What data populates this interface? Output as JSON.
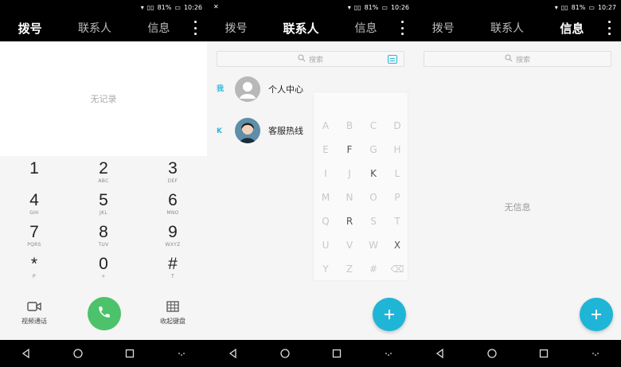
{
  "status": {
    "battery": "81%",
    "time_1": "10:26",
    "time_2": "10:26",
    "time_3": "10:27"
  },
  "tabs": {
    "dial": "拨号",
    "contacts": "联系人",
    "messages": "信息"
  },
  "dialer": {
    "empty_log": "无记录",
    "keys": [
      {
        "num": "1",
        "sub": ""
      },
      {
        "num": "2",
        "sub": "ABC"
      },
      {
        "num": "3",
        "sub": "DEF"
      },
      {
        "num": "4",
        "sub": "GHI"
      },
      {
        "num": "5",
        "sub": "JKL"
      },
      {
        "num": "6",
        "sub": "MNO"
      },
      {
        "num": "7",
        "sub": "PQRS"
      },
      {
        "num": "8",
        "sub": "TUV"
      },
      {
        "num": "9",
        "sub": "WXYZ"
      },
      {
        "num": "*",
        "sub": "P"
      },
      {
        "num": "0",
        "sub": "+"
      },
      {
        "num": "#",
        "sub": "T"
      }
    ],
    "video_call_label": "视频通话",
    "hide_keyboard_label": "收起键盘"
  },
  "contacts": {
    "search_placeholder": "搜索",
    "groups": [
      {
        "letter": "我",
        "name": "个人中心"
      },
      {
        "letter": "K",
        "name": "客服热线"
      }
    ],
    "alphabet": [
      "A",
      "B",
      "C",
      "D",
      "E",
      "F",
      "G",
      "H",
      "I",
      "J",
      "K",
      "L",
      "M",
      "N",
      "O",
      "P",
      "Q",
      "R",
      "S",
      "T",
      "U",
      "V",
      "W",
      "X",
      "Y",
      "Z",
      "#",
      "⌫"
    ],
    "active_letters": [
      "F",
      "K",
      "R",
      "X"
    ]
  },
  "messages": {
    "search_placeholder": "搜索",
    "empty_msg": "无信息"
  },
  "colors": {
    "accent": "#1fb5d6",
    "call_green": "#4cc26a"
  }
}
